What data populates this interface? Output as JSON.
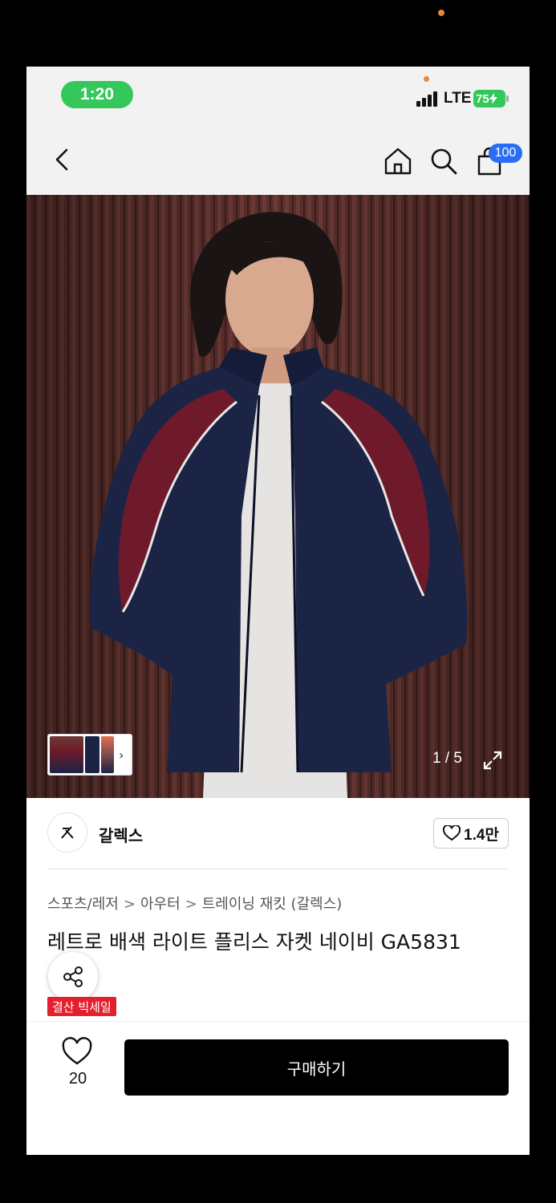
{
  "status_bar": {
    "time": "1:20",
    "network": "LTE",
    "battery": "75"
  },
  "nav": {
    "cart_badge": "100",
    "icons": [
      "back-icon",
      "home-icon",
      "search-icon",
      "cart-icon"
    ]
  },
  "gallery": {
    "page_counter": "1 / 5",
    "current_image": 1,
    "total_images": 5
  },
  "brand": {
    "name": "갈렉스",
    "likes": "1.4만"
  },
  "breadcrumb": [
    "스포츠/레저",
    "아우터",
    "트레이닝 재킷 (갈렉스)"
  ],
  "product": {
    "title": "레트로 배색 라이트 플리스 자켓 네이비 GA5831",
    "sale_badge": "결산 빅세일"
  },
  "bottom_bar": {
    "wish_count": "20",
    "buy_label": "구매하기"
  },
  "colors": {
    "status_green": "#34c759",
    "badge_blue": "#2a6df5",
    "sale_red": "#e5202e",
    "buy_button": "#000000"
  }
}
